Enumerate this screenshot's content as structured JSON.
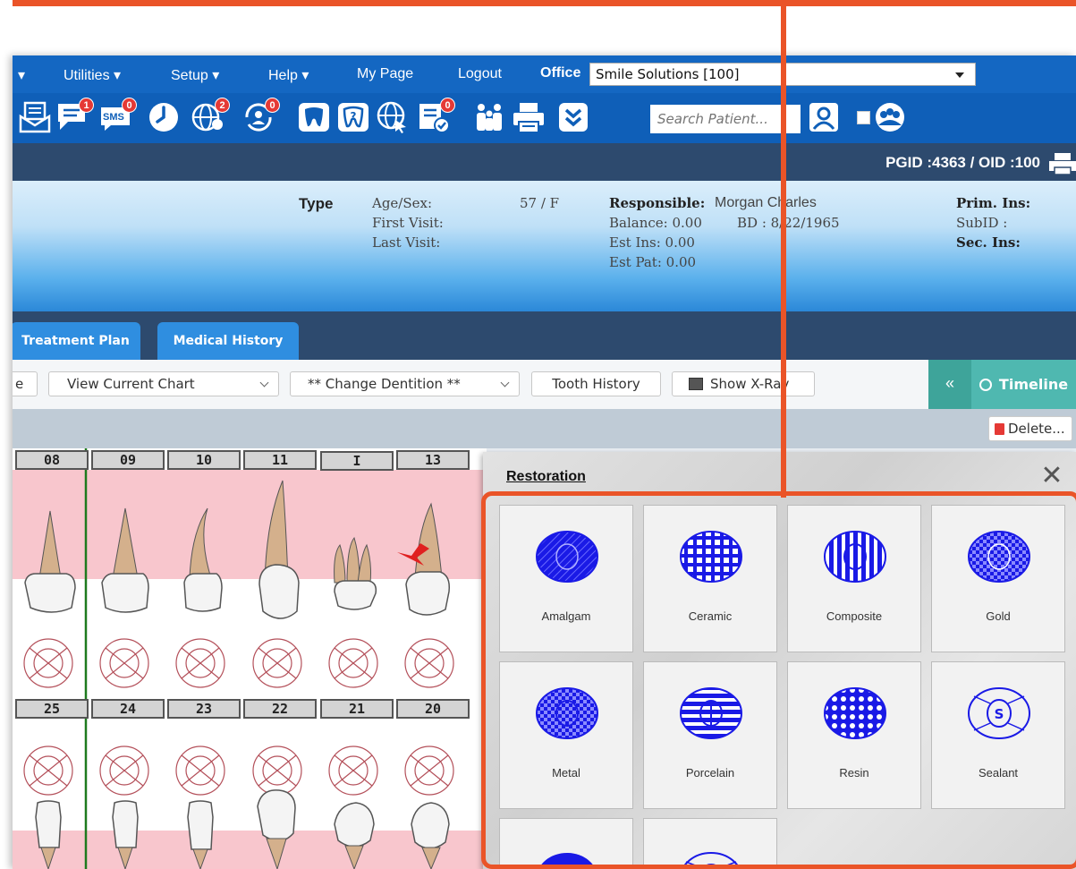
{
  "menu": {
    "items": [
      "▾",
      "Utilities ▾",
      "Setup ▾",
      "Help ▾",
      "My Page",
      "Logout"
    ],
    "office_label": "Office",
    "office_value": "Smile Solutions [100]"
  },
  "toolbar_icons": {
    "badges": {
      "messages": "1",
      "sms": "0",
      "globe": "2",
      "sync": "0",
      "checklist": "0"
    },
    "sms_label": "SMS",
    "search_placeholder": "Search Patient..."
  },
  "header": {
    "ids": "PGID :4363 / OID :100"
  },
  "patient": {
    "type_label": "Type",
    "age_sex_label": "Age/Sex:",
    "age_sex_value": "57 / F",
    "first_visit_label": "First Visit:",
    "last_visit_label": "Last Visit:",
    "responsible_label": "Responsible:",
    "responsible_value": "Morgan Charles",
    "balance": "Balance: 0.00",
    "dob": "BD : 8/22/1965",
    "est_ins": "Est Ins: 0.00",
    "est_pat": "Est Pat: 0.00",
    "prim_ins": "Prim. Ins:",
    "sub_id": "SubID :",
    "sec_ins": "Sec. Ins:"
  },
  "tabs": [
    "Treatment Plan",
    "Medical History"
  ],
  "chart_toolbar": {
    "partial_button": "e",
    "view_select": "View Current Chart",
    "dentition_select": "** Change Dentition **",
    "tooth_history": "Tooth History",
    "show_xray": "Show X-Ray",
    "collapse": "«",
    "timeline": "Timeline",
    "delete": "Delete..."
  },
  "teeth": {
    "upper": [
      "08",
      "09",
      "10",
      "11",
      "I",
      "13"
    ],
    "lower": [
      "25",
      "24",
      "23",
      "22",
      "21",
      "20"
    ]
  },
  "colors": {
    "menu_blue": "#1467c2",
    "navy": "#2d4a6e",
    "tab_blue": "#2f8ee0",
    "timeline_teal": "#4fb8b0",
    "annotation": "#ea5428",
    "restoration_blue": "#1a1ae6",
    "gum_pink": "#f8c6cd"
  },
  "dialog": {
    "title": "Restoration",
    "close": "✕",
    "tiles": [
      {
        "label": "Amalgam"
      },
      {
        "label": "Ceramic"
      },
      {
        "label": "Composite"
      },
      {
        "label": "Gold"
      },
      {
        "label": "Metal"
      },
      {
        "label": "Porcelain"
      },
      {
        "label": "Resin"
      },
      {
        "label": "Sealant"
      },
      {
        "label": ""
      },
      {
        "label": ""
      }
    ]
  }
}
